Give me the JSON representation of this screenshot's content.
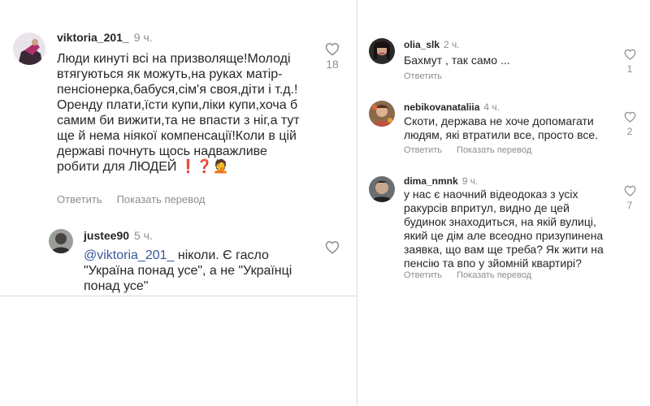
{
  "left": {
    "comment": {
      "username": "viktoria_201_",
      "time": "9 ч.",
      "text": "Люди кинуті всі на призволяще!Молоді втягуються як можуть,на руках матір-пенсіонерка,бабуся,сім'я своя,діти і т.д.!Оренду плати,їсти купи,ліки купи,хоча б самим би вижити,та не впасти з ніг,а тут ще й нема ніякої компенсації!Коли в цій державі почнуть щось надважливе робити для ЛЮДЕЙ ❗❓🤦",
      "reply_label": "Ответить",
      "translate_label": "Показать перевод",
      "likes": "18"
    },
    "reply": {
      "username": "justee90",
      "time": "5 ч.",
      "mention": "@viktoria_201_",
      "text": " ніколи. Є гасло \"Україна понад усе\", а не \"Українці понад усе\""
    }
  },
  "right": {
    "comments": [
      {
        "username": "olia_slk",
        "time": "2 ч.",
        "text": "Бахмут , так само ...",
        "reply_label": "Ответить",
        "likes": "1"
      },
      {
        "username": "nebikovanataliia",
        "time": "4 ч.",
        "text": "Скоти, держава не хоче допомагати людям, які втратили все, просто все.",
        "reply_label": "Ответить",
        "translate_label": "Показать перевод",
        "likes": "2"
      },
      {
        "username": "dima_nmnk",
        "time": "9 ч.",
        "text": "у нас є наочний відеодоказ з усіх ракурсів впритул, видно де цей будинок знаходиться, на якій вулиці, який це дім але всеодно призупинена заявка, що вам ще треба? Як жити на пенсію та впо у зйомній квартирі?",
        "reply_label": "Ответить",
        "translate_label": "Показать перевод",
        "likes": "7"
      }
    ]
  },
  "icons": {
    "like": "heart-outline-icon"
  },
  "colors": {
    "text": "#262626",
    "secondary": "#8e8e8e",
    "mention": "#385898",
    "divider": "#dbdbdb"
  }
}
